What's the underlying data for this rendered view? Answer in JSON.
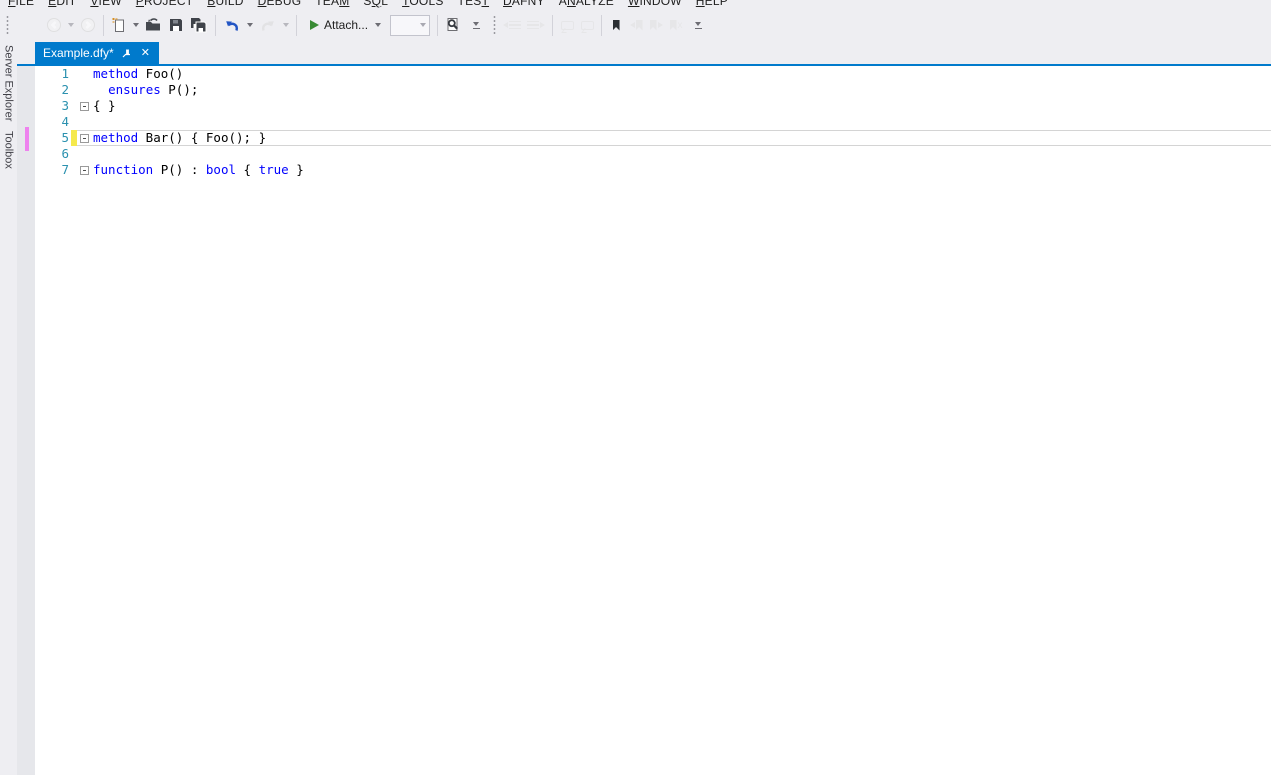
{
  "menu": {
    "items": [
      {
        "label": "FILE",
        "accel": 0
      },
      {
        "label": "EDIT",
        "accel": 0
      },
      {
        "label": "VIEW",
        "accel": 0
      },
      {
        "label": "PROJECT",
        "accel": 0
      },
      {
        "label": "BUILD",
        "accel": 0
      },
      {
        "label": "DEBUG",
        "accel": 0
      },
      {
        "label": "TEAM",
        "accel": 3
      },
      {
        "label": "SQL",
        "accel": 1
      },
      {
        "label": "TOOLS",
        "accel": 0
      },
      {
        "label": "TEST",
        "accel": 3
      },
      {
        "label": "DAFNY",
        "accel": 0
      },
      {
        "label": "ANALYZE",
        "accel": 1
      },
      {
        "label": "WINDOW",
        "accel": 0
      },
      {
        "label": "HELP",
        "accel": 0
      }
    ]
  },
  "toolbar": {
    "attach_label": "Attach...",
    "combo_value": ""
  },
  "tab": {
    "title": "Example.dfy*"
  },
  "side_tabs": [
    {
      "label": "Server Explorer"
    },
    {
      "label": "Toolbox"
    }
  ],
  "icons": {
    "close": "✕"
  },
  "editor": {
    "lines": [
      {
        "num": "1",
        "fold": false,
        "changed": false,
        "current": false,
        "tokens": [
          {
            "c": "kw",
            "t": "method"
          },
          {
            "c": "pl",
            "t": " Foo()"
          }
        ]
      },
      {
        "num": "2",
        "fold": false,
        "changed": false,
        "current": false,
        "tokens": [
          {
            "c": "pl",
            "t": "  "
          },
          {
            "c": "kw",
            "t": "ensures"
          },
          {
            "c": "pl",
            "t": " P();"
          }
        ]
      },
      {
        "num": "3",
        "fold": true,
        "changed": false,
        "current": false,
        "tokens": [
          {
            "c": "pl",
            "t": "{ }"
          }
        ]
      },
      {
        "num": "4",
        "fold": false,
        "changed": false,
        "current": false,
        "tokens": []
      },
      {
        "num": "5",
        "fold": true,
        "changed": true,
        "current": true,
        "tokens": [
          {
            "c": "kw",
            "t": "method"
          },
          {
            "c": "pl",
            "t": " Bar() { Foo(); }"
          }
        ]
      },
      {
        "num": "6",
        "fold": false,
        "changed": false,
        "current": false,
        "tokens": []
      },
      {
        "num": "7",
        "fold": true,
        "changed": false,
        "current": false,
        "tokens": [
          {
            "c": "kw",
            "t": "function"
          },
          {
            "c": "pl",
            "t": " P() : "
          },
          {
            "c": "kw",
            "t": "bool"
          },
          {
            "c": "pl",
            "t": " { "
          },
          {
            "c": "kw",
            "t": "true"
          },
          {
            "c": "pl",
            "t": " }"
          }
        ]
      }
    ]
  },
  "colors": {
    "accent": "#007ACC",
    "keyword": "#0000FF",
    "line_number": "#2B91AF",
    "changed_bar": "#F5E94C",
    "verify_marker": "#EE82EE",
    "chrome_bg": "#EEEEF2",
    "green": "#388A34",
    "undo_blue": "#2355C4",
    "icon_dark": "#3F434A"
  }
}
